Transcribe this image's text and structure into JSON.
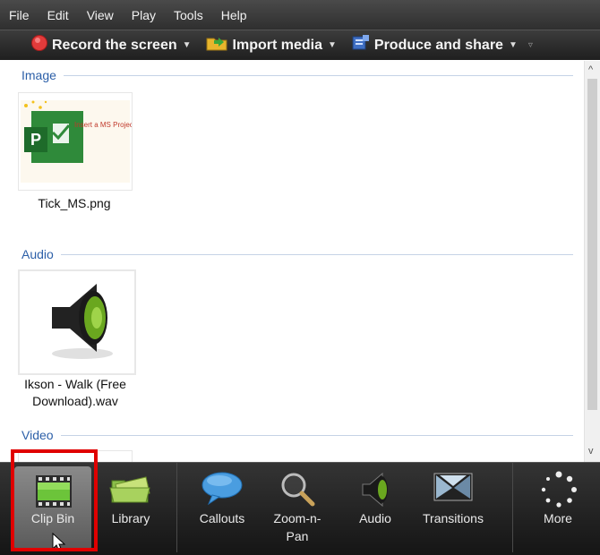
{
  "menu": [
    "File",
    "Edit",
    "View",
    "Play",
    "Tools",
    "Help"
  ],
  "toolbar": {
    "record_label": "Record the screen",
    "import_label": "Import media",
    "produce_label": "Produce and share"
  },
  "sections": {
    "image": {
      "title": "Image",
      "item_name": "Tick_MS.png",
      "thumb_text": "Insert a MS Project"
    },
    "audio": {
      "title": "Audio",
      "item_name_line1": "Ikson - Walk (Free",
      "item_name_line2": "Download).wav"
    },
    "video": {
      "title": "Video"
    }
  },
  "tabs": {
    "clip_bin": "Clip Bin",
    "library": "Library",
    "callouts": "Callouts",
    "zoom_line1": "Zoom-n-",
    "zoom_line2": "Pan",
    "audio": "Audio",
    "transitions": "Transitions",
    "more": "More"
  },
  "colors": {
    "accent_highlight": "#e00000",
    "section_title": "#2c5fa8"
  }
}
